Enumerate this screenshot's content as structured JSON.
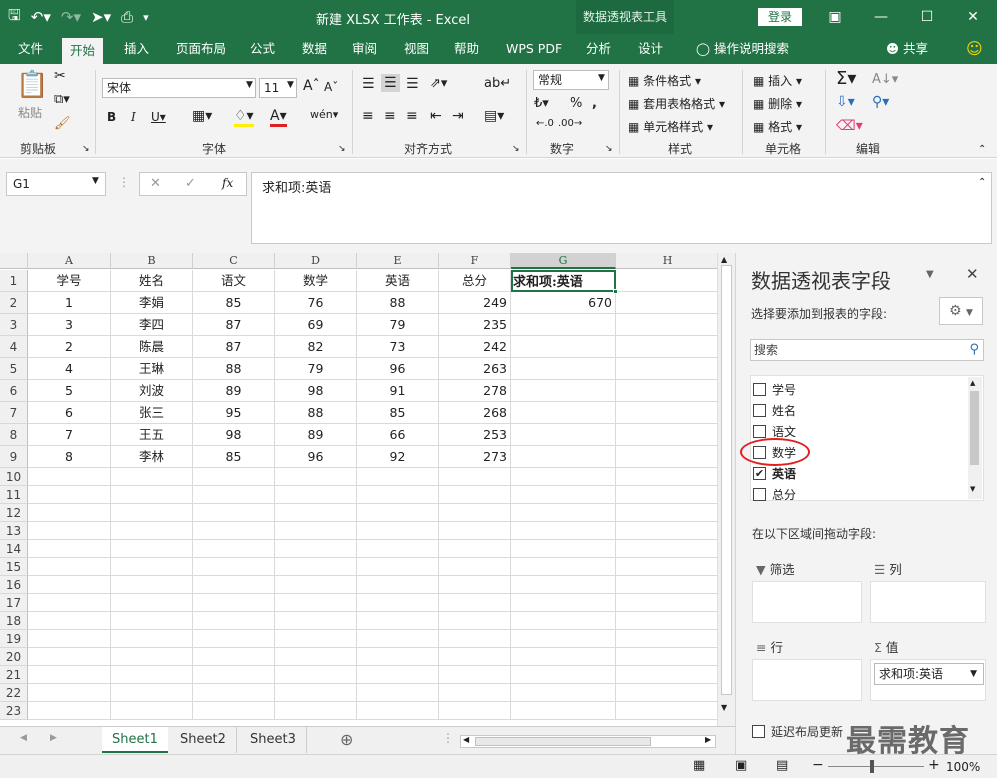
{
  "window": {
    "title": "新建 XLSX 工作表 - Excel",
    "context_tool": "数据透视表工具",
    "login_label": "登录"
  },
  "tabs": [
    {
      "label": "文件",
      "active": false
    },
    {
      "label": "开始",
      "active": true
    },
    {
      "label": "插入",
      "active": false
    },
    {
      "label": "页面布局",
      "active": false
    },
    {
      "label": "公式",
      "active": false
    },
    {
      "label": "数据",
      "active": false
    },
    {
      "label": "审阅",
      "active": false
    },
    {
      "label": "视图",
      "active": false
    },
    {
      "label": "帮助",
      "active": false
    },
    {
      "label": "WPS PDF",
      "active": false
    },
    {
      "label": "分析",
      "active": false
    },
    {
      "label": "设计",
      "active": false
    }
  ],
  "tell_me": "操作说明搜索",
  "share_label": "共享",
  "ribbon": {
    "clipboard": {
      "paste": "粘贴",
      "label": "剪贴板"
    },
    "font": {
      "name": "宋体",
      "size": "11",
      "label": "字体"
    },
    "alignment": {
      "label": "对齐方式"
    },
    "number": {
      "format": "常规",
      "label": "数字"
    },
    "styles": {
      "conditional": "条件格式",
      "table": "套用表格格式",
      "cell": "单元格样式",
      "label": "样式"
    },
    "cells": {
      "insert": "插入",
      "delete": "删除",
      "format": "格式",
      "label": "单元格"
    },
    "editing": {
      "label": "编辑"
    }
  },
  "formula_bar": {
    "name_box": "G1",
    "formula": "求和项:英语"
  },
  "grid": {
    "columns": [
      "A",
      "B",
      "C",
      "D",
      "E",
      "F",
      "G",
      "H"
    ],
    "selected_column": "G",
    "row_numbers": [
      "1",
      "2",
      "3",
      "4",
      "5",
      "6",
      "7",
      "8",
      "9",
      "10",
      "11",
      "12",
      "13",
      "14",
      "15",
      "16",
      "17",
      "18",
      "19",
      "20",
      "21",
      "22",
      "23"
    ],
    "header_row": [
      "学号",
      "姓名",
      "语文",
      "数学",
      "英语",
      "总分",
      "求和项:英语"
    ],
    "rows": [
      [
        "1",
        "李娟",
        "85",
        "76",
        "88",
        "249",
        "670"
      ],
      [
        "3",
        "李四",
        "87",
        "69",
        "79",
        "235",
        ""
      ],
      [
        "2",
        "陈晨",
        "87",
        "82",
        "73",
        "242",
        ""
      ],
      [
        "4",
        "王琳",
        "88",
        "79",
        "96",
        "263",
        ""
      ],
      [
        "5",
        "刘波",
        "89",
        "98",
        "91",
        "278",
        ""
      ],
      [
        "6",
        "张三",
        "95",
        "88",
        "85",
        "268",
        ""
      ],
      [
        "7",
        "王五",
        "98",
        "89",
        "66",
        "253",
        ""
      ],
      [
        "8",
        "李林",
        "85",
        "96",
        "92",
        "273",
        ""
      ]
    ]
  },
  "sheets": [
    {
      "label": "Sheet1",
      "active": true
    },
    {
      "label": "Sheet2",
      "active": false
    },
    {
      "label": "Sheet3",
      "active": false
    }
  ],
  "status": {
    "zoom": "100%"
  },
  "pivot_pane": {
    "title": "数据透视表字段",
    "subtitle": "选择要添加到报表的字段:",
    "search_placeholder": "搜索",
    "fields": [
      {
        "label": "学号",
        "checked": false
      },
      {
        "label": "姓名",
        "checked": false
      },
      {
        "label": "语文",
        "checked": false
      },
      {
        "label": "数学",
        "checked": false
      },
      {
        "label": "英语",
        "checked": true
      },
      {
        "label": "总分",
        "checked": false
      }
    ],
    "drag_label": "在以下区域间拖动字段:",
    "areas": {
      "filter": "筛选",
      "columns": "列",
      "rows": "行",
      "values": "值"
    },
    "value_item": "求和项:英语",
    "defer_label": "延迟布局更新",
    "watermark": "最需教育"
  }
}
